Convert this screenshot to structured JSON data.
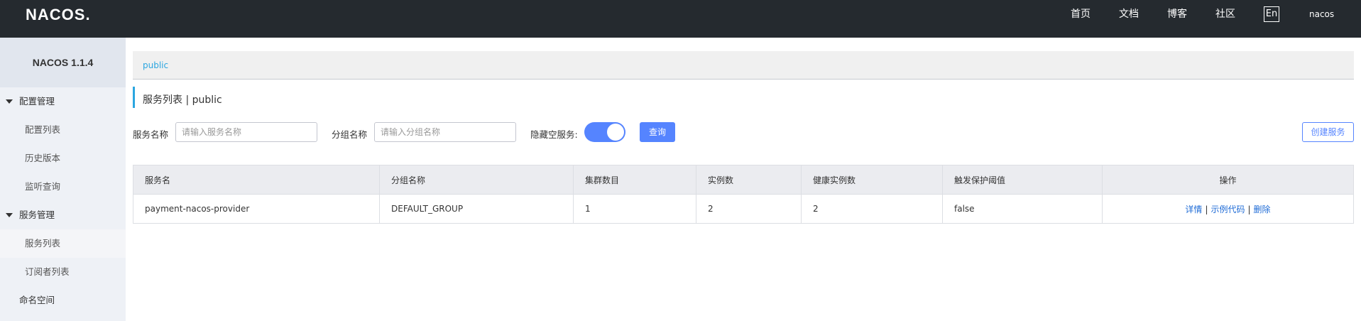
{
  "header": {
    "logo": "NACOS.",
    "nav": [
      "首页",
      "文档",
      "博客",
      "社区"
    ],
    "lang": "En",
    "user": "nacos"
  },
  "sidebar": {
    "version": "NACOS 1.1.4",
    "groups": [
      {
        "label": "配置管理",
        "items": [
          "配置列表",
          "历史版本",
          "监听查询"
        ]
      },
      {
        "label": "服务管理",
        "items": [
          "服务列表",
          "订阅者列表"
        ]
      }
    ],
    "namespace": "命名空间",
    "active_item": "服务列表"
  },
  "breadcrumb": "public",
  "page_title": "服务列表 | public",
  "filters": {
    "service_name_label": "服务名称",
    "service_name_placeholder": "请输入服务名称",
    "group_name_label": "分组名称",
    "group_name_placeholder": "请输入分组名称",
    "hide_empty_label": "隐藏空服务:",
    "hide_empty_on": true,
    "query_button": "查询",
    "create_button": "创建服务"
  },
  "table": {
    "columns": [
      "服务名",
      "分组名称",
      "集群数目",
      "实例数",
      "健康实例数",
      "触发保护阈值",
      "操作"
    ],
    "rows": [
      {
        "service": "payment-nacos-provider",
        "group": "DEFAULT_GROUP",
        "clusters": "1",
        "instances": "2",
        "healthy": "2",
        "threshold": "false",
        "actions": [
          "详情",
          "示例代码",
          "删除"
        ]
      }
    ]
  },
  "colors": {
    "topbar": "#252a2f",
    "accent": "#5584ff",
    "link": "#1e6bd6",
    "breadcrumb": "#2ba6e0"
  }
}
